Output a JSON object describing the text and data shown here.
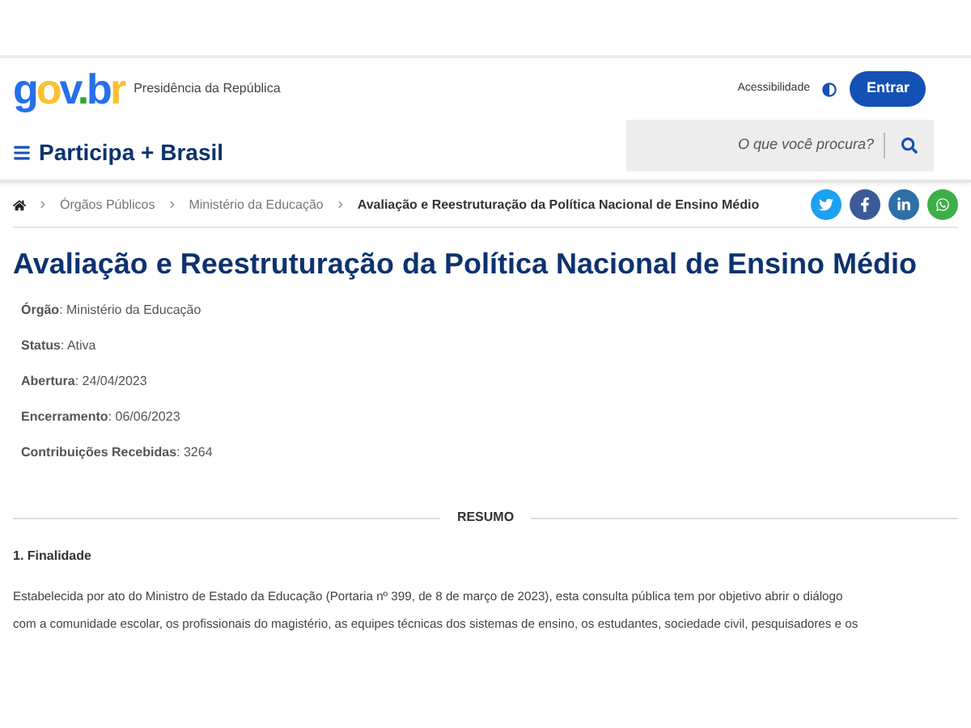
{
  "header": {
    "logo": [
      {
        "char": "g",
        "color": "#2670e8"
      },
      {
        "char": "o",
        "color": "#f9c12e"
      },
      {
        "char": "v",
        "color": "#2670e8"
      },
      {
        "char": ".",
        "color": "#2fa836"
      },
      {
        "char": "b",
        "color": "#2670e8"
      },
      {
        "char": "r",
        "color": "#f9c12e"
      }
    ],
    "org": "Presidência da República",
    "accessibility": "Acessibilidade",
    "login": "Entrar",
    "site_title": "Participa + Brasil",
    "search": {
      "placeholder": "O que você procura?"
    }
  },
  "breadcrumb": [
    "Órgãos Públicos",
    "Ministério da Educação",
    "Avaliação e Reestruturação da Política Nacional de Ensino Médio"
  ],
  "title": "Avaliação e Reestruturação da Política Nacional de Ensino Médio",
  "details": [
    "**Órgão**: Ministério da Educação",
    "**Status**: Ativa",
    "**Abertura**: 24/04/2023",
    "**Encerramento**: 06/06/2023",
    "**Contribuições Recebidas**: 3264"
  ],
  "summary": {
    "heading": "RESUMO",
    "section": "1. Finalidade",
    "lines": [
      "Estabelecida por ato do Ministro de Estado da Educação (Portaria nº 399, de 8 de março de 2023), esta consulta pública tem por objetivo abrir o diálogo",
      "com a comunidade escolar, os profissionais do magistério, as equipes técnicas dos sistemas de ensino, os estudantes, sociedade civil, pesquisadores e os"
    ]
  }
}
